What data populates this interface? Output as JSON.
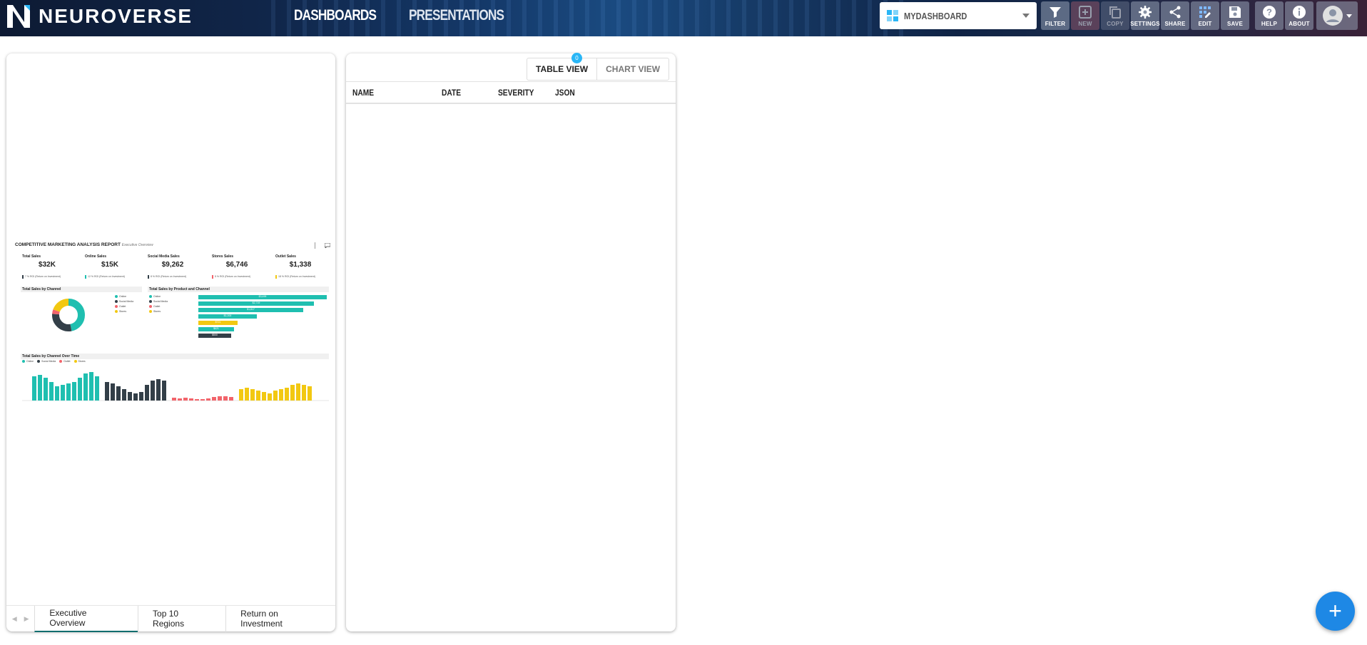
{
  "app": {
    "name": "NEUROVERSE"
  },
  "nav": {
    "dashboards": "DASHBOARDS",
    "presentations": "PRESENTATIONS"
  },
  "dashboard_select": {
    "value": "MYDASHBOARD"
  },
  "toolbar": {
    "filter": "FILTER",
    "new": "NEW",
    "copy": "COPY",
    "settings": "SETTINGS",
    "share": "SHARE",
    "edit": "EDIT",
    "save": "SAVE",
    "help": "HELP",
    "about": "ABOUT"
  },
  "report": {
    "title": "COMPETITIVE MARKETING ANALYSIS REPORT",
    "subtitle": "Executive Overview",
    "kpis": [
      {
        "label": "Total Sales",
        "value": "$32K"
      },
      {
        "label": "Online Sales",
        "value": "$15K"
      },
      {
        "label": "Social Media Sales",
        "value": "$9,262"
      },
      {
        "label": "Stores Sales",
        "value": "$6,746"
      },
      {
        "label": "Outlet Sales",
        "value": "$1,338"
      }
    ],
    "roi": [
      "7 % ROI (Return on Investment)",
      "12 % ROI (Return on Investment)",
      "8 % ROI (Return on Investment)",
      "5 % ROI (Return on Investment)",
      "18 % ROI (Return on Investment)"
    ],
    "channel_card": "Total Sales by Channel",
    "product_card": "Total Sales by Product and Channel",
    "time_card": "Total Sales by Channel Over Time",
    "channels": [
      "Online",
      "Social Media",
      "Outlet",
      "Stores"
    ],
    "colors": {
      "online": "#1fbfb0",
      "social": "#333f48",
      "outlet": "#f2646b",
      "stores": "#f2c811"
    },
    "bar_labels": [
      "$3,499",
      "$2,719",
      "$1,817",
      "$1,000",
      "$721",
      "$621",
      "$500"
    ]
  },
  "report_tabs": [
    "Executive Overview",
    "Top 10 Regions",
    "Return on Investment"
  ],
  "view_toggle": {
    "table": "TABLE VIEW",
    "chart": "CHART VIEW",
    "badge": "0"
  },
  "table": {
    "columns": [
      "NAME",
      "DATE",
      "SEVERITY",
      "JSON"
    ]
  },
  "fab": {
    "label": "+"
  }
}
